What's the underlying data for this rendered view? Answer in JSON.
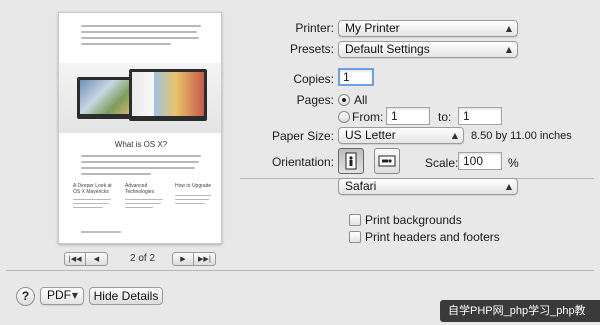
{
  "preview": {
    "heading": "What is OS X?",
    "columns": [
      "A Deeper Look at OS X Mavericks",
      "Advanced Technologies",
      "How to Upgrade"
    ],
    "page_indicator": "2 of 2"
  },
  "form": {
    "printer_label": "Printer:",
    "printer_value": "My Printer",
    "presets_label": "Presets:",
    "presets_value": "Default Settings",
    "copies_label": "Copies:",
    "copies_value": "1",
    "pages_label": "Pages:",
    "pages_all_label": "All",
    "pages_from_label": "From:",
    "pages_from_value": "1",
    "pages_to_label": "to:",
    "pages_to_value": "1",
    "paper_size_label": "Paper Size:",
    "paper_size_value": "US Letter",
    "paper_size_dims": "8.50 by 11.00 inches",
    "orientation_label": "Orientation:",
    "scale_label": "Scale:",
    "scale_value": "100",
    "scale_unit": "%",
    "app_section_value": "Safari",
    "print_backgrounds_label": "Print backgrounds",
    "print_headers_label": "Print headers and footers"
  },
  "footer": {
    "help_label": "?",
    "pdf_label": "PDF",
    "hide_details_label": "Hide Details"
  },
  "watermark": "自学PHP网_php学习_php教"
}
